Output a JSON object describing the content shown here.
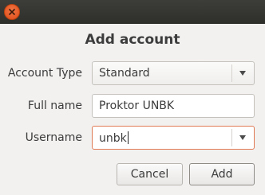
{
  "window": {
    "close_icon": "close-icon"
  },
  "dialog": {
    "title": "Add account"
  },
  "form": {
    "account_type": {
      "label": "Account Type",
      "value": "Standard"
    },
    "full_name": {
      "label": "Full name",
      "value": "Proktor UNBK"
    },
    "username": {
      "label": "Username",
      "value": "unbk"
    }
  },
  "buttons": {
    "cancel": "Cancel",
    "add": "Add"
  },
  "colors": {
    "focus_border": "#e07a55",
    "close_button": "#df4a16"
  }
}
